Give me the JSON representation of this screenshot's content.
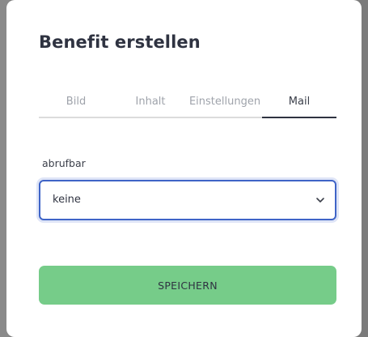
{
  "dialog": {
    "title": "Benefit erstellen"
  },
  "tabs": [
    {
      "label": "Bild",
      "active": false
    },
    {
      "label": "Inhalt",
      "active": false
    },
    {
      "label": "Einstellungen",
      "active": false
    },
    {
      "label": "Mail",
      "active": true
    }
  ],
  "form": {
    "field_label": "abrufbar",
    "select_value": "keine",
    "select_icon": "chevron-down-icon"
  },
  "actions": {
    "save_label": "SPEICHERN"
  },
  "colors": {
    "accent_border": "#3f64c7",
    "save_button": "#76cc89",
    "text_dark": "#2f3341",
    "tab_inactive": "#9fa3ab"
  }
}
